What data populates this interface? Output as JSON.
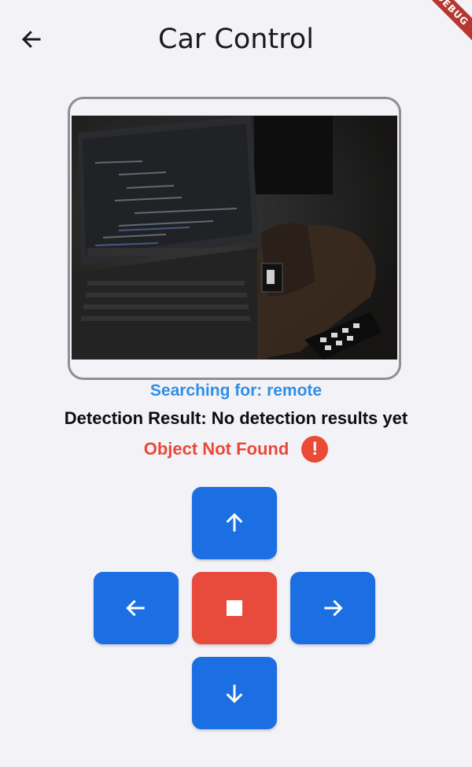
{
  "appbar": {
    "title": "Car Control",
    "back_icon": "arrow-left-icon"
  },
  "debug_banner": {
    "label": "DEBUG"
  },
  "camera": {
    "label": "camera-feed"
  },
  "status": {
    "searching": "Searching for: remote",
    "detection": "Detection Result: No detection results yet",
    "object_state": "Object Not Found",
    "alert_icon": "!"
  },
  "controls": {
    "up_icon": "arrow-up-icon",
    "left_icon": "arrow-left-icon",
    "stop_icon": "stop-icon",
    "right_icon": "arrow-right-icon",
    "down_icon": "arrow-down-icon"
  },
  "colors": {
    "background": "#f3f2f6",
    "primary": "#1b6fe3",
    "stop": "#e84a3c",
    "searching_text": "#2f8fe6",
    "not_found_text": "#e8483a"
  }
}
